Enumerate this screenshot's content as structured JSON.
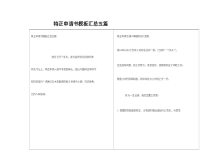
{
  "document": {
    "title": "特正申请书模板汇总五篇",
    "left_column": [
      "转正申请书模板汇总五篇",
      "我去了四个多月。我们金贸同同百修申请",
      "来实习为上。转正申请入我本有前的确认。固公司管转正申请书",
      "的的前端行？请各位办大发最想的转正申请书上篇，仅供参考。",
      "无的人家阅读。"
    ],
    "right_column": [
      "转正申请书 篇1事期的月行发际",
      "我xx年x月x日来到公司前往合财一部。已经有一个多月了。",
      "在这段时间里。我工作努力。表现良好。按照现来反了本职工作。",
      "根据公司的规章制度。现申请成为公司的正式一员。",
      "作为一名出纳。我的主要工作是：",
      "1. 根据财务制度的规定，分别按时登出缴纳中心导办。代表表"
    ]
  }
}
